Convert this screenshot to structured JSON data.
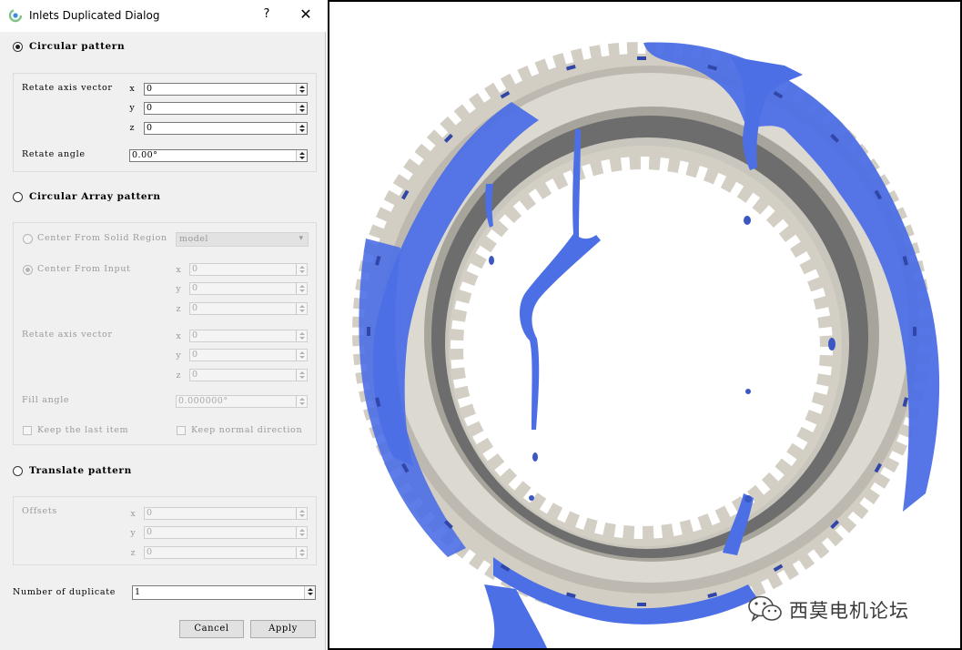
{
  "window": {
    "title": "Inlets Duplicated Dialog",
    "help": "?",
    "close": "✕",
    "icon": "swirl-app-icon"
  },
  "circular": {
    "label": "Circular pattern",
    "selected": true,
    "rotate_axis_label": "Retate axis vector",
    "axes": [
      "x",
      "y",
      "z"
    ],
    "x": "0",
    "y": "0",
    "z": "0",
    "angle_label": "Retate angle",
    "angle": "0.00°"
  },
  "array": {
    "label": "Circular Array pattern",
    "selected": false,
    "center_solid_label": "Center From Solid Region",
    "center_solid_value": "model",
    "center_input_label": "Center From Input",
    "cx": "0",
    "cy": "0",
    "cz": "0",
    "axis_label": "Retate axis vector",
    "ax": "0",
    "ay": "0",
    "az": "0",
    "fill_label": "Fill angle",
    "fill_value": "0.000000°",
    "keep_last": "Keep the last item",
    "keep_normal": "Keep normal direction"
  },
  "translate": {
    "label": "Translate pattern",
    "selected": false,
    "offsets_label": "Offsets",
    "ox": "0",
    "oy": "0",
    "oz": "0"
  },
  "duplicates": {
    "label": "Number of duplicate",
    "value": "1"
  },
  "buttons": {
    "cancel": "Cancel",
    "apply": "Apply"
  },
  "viewport": {
    "watermark": "西莫电机论坛",
    "colors": {
      "ring": "#cfcbbf",
      "tube": "#d8d5cc",
      "shadow": "#5d5d5d",
      "fluid": "#4d6fe6",
      "fluid_dark": "#3b57c4"
    }
  }
}
